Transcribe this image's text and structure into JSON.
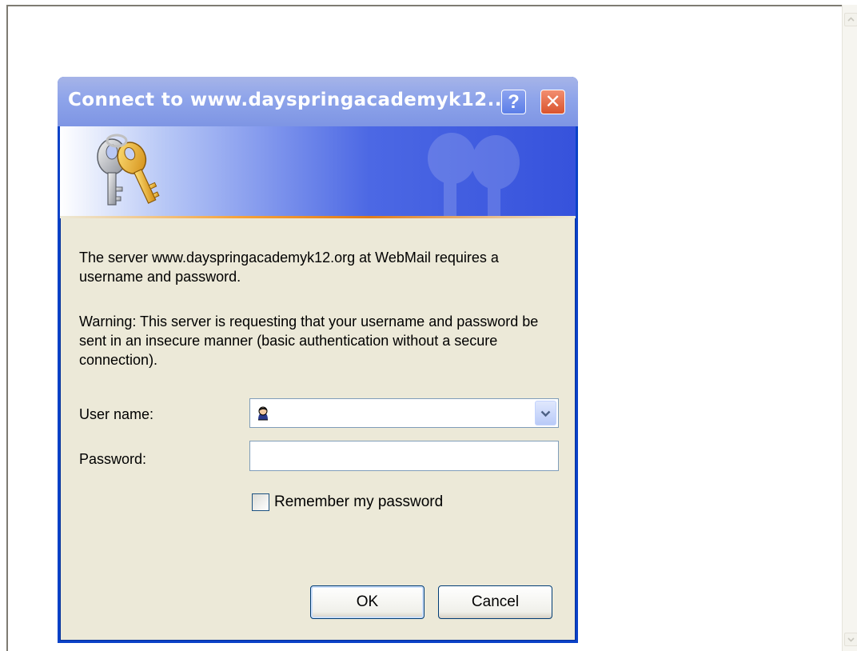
{
  "dialog": {
    "title": "Connect to www.dayspringacademyk12....",
    "help_button": "?",
    "close_button": "✕",
    "message": "The server www.dayspringacademyk12.org at WebMail requires a username and password.",
    "warning": "Warning: This server is requesting that your username and password be sent in an insecure manner (basic authentication without a secure connection).",
    "username_label": "User name:",
    "username_value": "",
    "password_label": "Password:",
    "password_value": "",
    "remember_label": "Remember my password",
    "remember_checked": false,
    "ok_label": "OK",
    "cancel_label": "Cancel"
  },
  "icons": {
    "banner": "keys-icon",
    "user": "user-avatar-icon",
    "dropdown": "chevron-down-icon",
    "scroll_up": "scroll-up-arrow-icon",
    "scroll_down": "scroll-down-arrow-icon"
  },
  "colors": {
    "dialog_face": "#ece9d8",
    "title_bar": "#8ea4ea",
    "close_button": "#d9542e",
    "frame_border": "#0a42c8"
  }
}
